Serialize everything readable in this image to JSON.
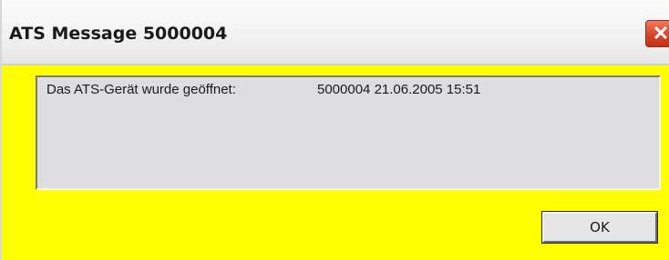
{
  "window": {
    "title": "ATS Message 5000004",
    "close_icon": "close-icon",
    "background_color": "#ffff00"
  },
  "message": {
    "label": "Das ATS-Gerät wurde geöffnet:",
    "value": "5000004 21.06.2005 15:51"
  },
  "buttons": {
    "ok_label": "OK"
  },
  "colors": {
    "close_button": "#d9442a",
    "panel": "#dedde2"
  }
}
